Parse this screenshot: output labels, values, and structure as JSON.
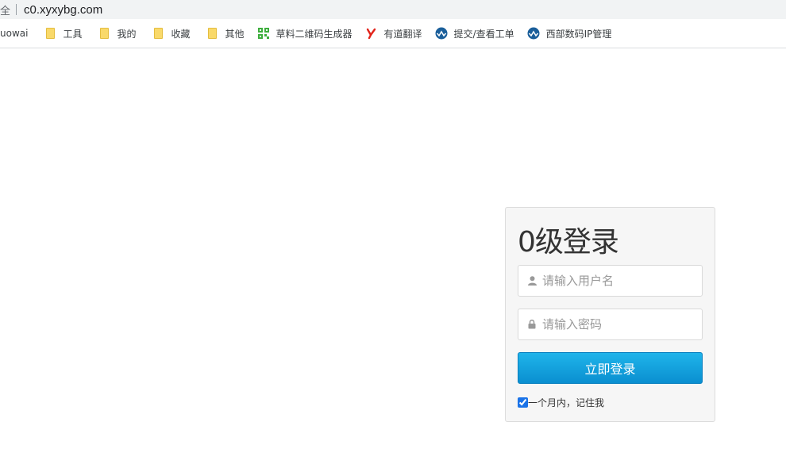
{
  "browser": {
    "secure_label": "全",
    "url": "c0.xyxybg.com"
  },
  "bookmarks": [
    {
      "label": "uowai",
      "icon": "none"
    },
    {
      "label": "工具",
      "icon": "folder-icon"
    },
    {
      "label": "我的",
      "icon": "folder-icon"
    },
    {
      "label": "收藏",
      "icon": "folder-icon"
    },
    {
      "label": "其他",
      "icon": "folder-icon"
    },
    {
      "label": "草料二维码生成器",
      "icon": "qrcode-icon"
    },
    {
      "label": "有道翻译",
      "icon": "youdao-icon"
    },
    {
      "label": "提交/查看工单",
      "icon": "west-icon"
    },
    {
      "label": "西部数码IP管理",
      "icon": "west-icon"
    }
  ],
  "login": {
    "title": "0级登录",
    "username_placeholder": "请输入用户名",
    "password_placeholder": "请输入密码",
    "submit_label": "立即登录",
    "remember_label": "一个月内，记住我",
    "remember_checked": true
  },
  "colors": {
    "button_top": "#1fb4ea",
    "button_bottom": "#0a8fd0",
    "folder": "#f9d96a",
    "qrcode": "#3dae3d",
    "youdao": "#e2231a",
    "west": "#1a5e9a"
  }
}
